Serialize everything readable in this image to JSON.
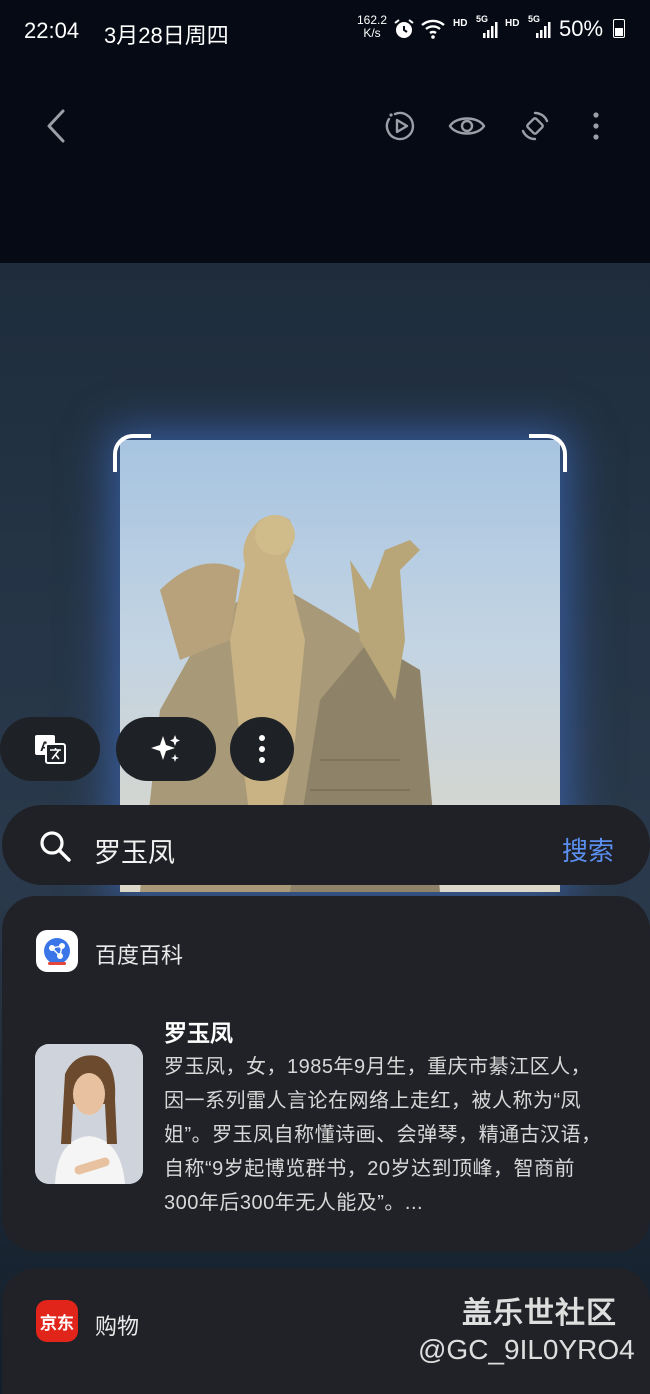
{
  "status_bar": {
    "time": "22:04",
    "date": "3月28日周四",
    "net_speed_value": "162.2",
    "net_speed_unit": "K/s",
    "hd1": "HD",
    "sig1": "5G",
    "hd2": "HD",
    "sig2": "5G",
    "battery": "50%"
  },
  "toolbar": {
    "icons": [
      "back-icon",
      "play-motion-icon",
      "eye-icon",
      "rotate-icon",
      "more-icon"
    ]
  },
  "actions": {
    "icons": [
      "translate-icon",
      "sparkle-icon",
      "more-vertical-icon"
    ]
  },
  "search": {
    "query": "罗玉凤",
    "button_label": "搜索",
    "accent_color": "#5b8ff0"
  },
  "result": {
    "source_name": "百度百科",
    "title": "罗玉凤",
    "description": "罗玉凤，女，1985年9月生，重庆市綦江区人，因一系列雷人言论在网络上走红，被人称为“凤姐”。罗玉凤自称懂诗画、会弹琴，精通古汉语，自称“9岁起博览群书，20岁达到顶峰，智商前300年后300年无人能及”。..."
  },
  "shopping": {
    "logo_text": "京东",
    "label": "购物"
  },
  "watermark": {
    "line1": "盖乐世社区",
    "line2": "@GC_9IL0YRO4"
  }
}
